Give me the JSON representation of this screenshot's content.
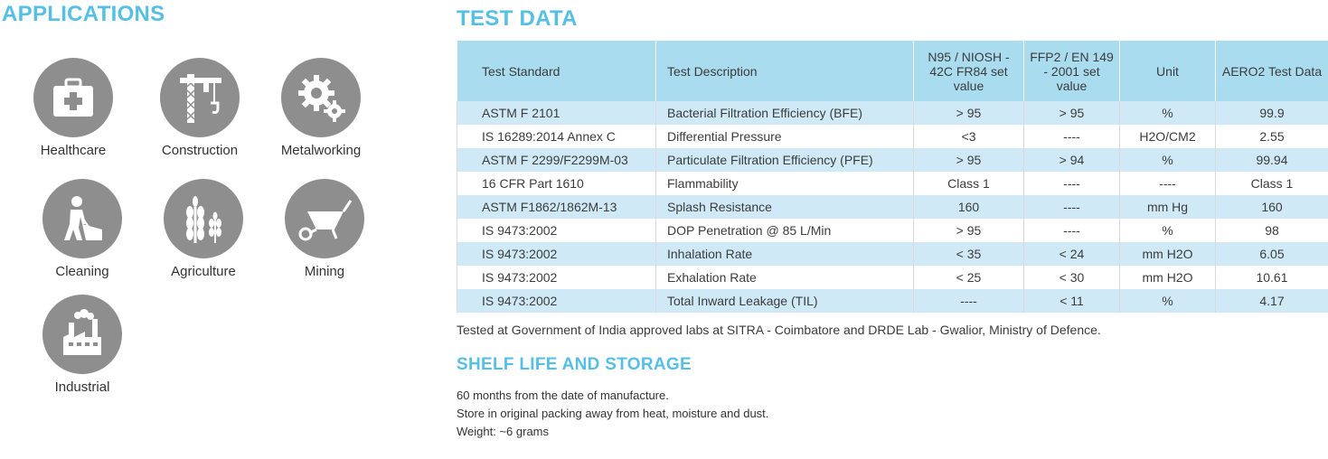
{
  "applications": {
    "title": "APPLICATIONS",
    "items": [
      {
        "label": "Healthcare",
        "icon": "medical-kit-icon"
      },
      {
        "label": "Construction",
        "icon": "crane-icon"
      },
      {
        "label": "Metalworking",
        "icon": "gears-icon"
      },
      {
        "label": "Cleaning",
        "icon": "cleaning-worker-icon"
      },
      {
        "label": "Agriculture",
        "icon": "wheat-icon"
      },
      {
        "label": "Mining",
        "icon": "wheelbarrow-icon"
      },
      {
        "label": "Industrial",
        "icon": "factory-icon"
      }
    ]
  },
  "test_data": {
    "title": "TEST DATA",
    "headers": [
      "Test Standard",
      "Test Description",
      "N95 / NIOSH - 42C FR84 set value",
      "FFP2 / EN 149 - 2001 set value",
      "Unit",
      "AERO2 Test Data"
    ],
    "rows": [
      [
        "ASTM F 2101",
        "Bacterial Filtration Efficiency (BFE)",
        "> 95",
        ">  95",
        "%",
        "99.9"
      ],
      [
        "IS 16289:2014 Annex C",
        "Differential Pressure",
        "<3",
        "----",
        "H2O/CM2",
        "2.55"
      ],
      [
        "ASTM F 2299/F2299M-03",
        "Particulate Filtration Efficiency (PFE)",
        "> 95",
        "> 94",
        "%",
        "99.94"
      ],
      [
        "16 CFR Part 1610",
        "Flammability",
        "Class 1",
        "----",
        "----",
        "Class 1"
      ],
      [
        "ASTM F1862/1862M-13",
        "Splash Resistance",
        "160",
        "----",
        "mm Hg",
        "160"
      ],
      [
        "IS 9473:2002",
        "DOP Penetration @ 85 L/Min",
        "> 95",
        "----",
        "%",
        "98"
      ],
      [
        "IS 9473:2002",
        "Inhalation Rate",
        "< 35",
        "< 24",
        "mm H2O",
        "6.05"
      ],
      [
        "IS 9473:2002",
        "Exhalation Rate",
        "< 25",
        "< 30",
        "mm H2O",
        "10.61"
      ],
      [
        "IS 9473:2002",
        "Total Inward Leakage (TIL)",
        "----",
        "< 11",
        "%",
        "4.17"
      ]
    ],
    "footnote": "Tested at Government of India approved labs at SITRA - Coimbatore and DRDE Lab - Gwalior, Ministry of Defence."
  },
  "shelf": {
    "title": "SHELF LIFE AND STORAGE",
    "lines": [
      "60 months from the date of manufacture.",
      "Store in original packing away from heat, moisture and dust.",
      "Weight: ~6 grams"
    ]
  },
  "colors": {
    "accent": "#55bfe6",
    "header_bg": "#a9dcef",
    "row_alt": "#cfeaf6",
    "icon_bg": "#8e8e8e"
  }
}
